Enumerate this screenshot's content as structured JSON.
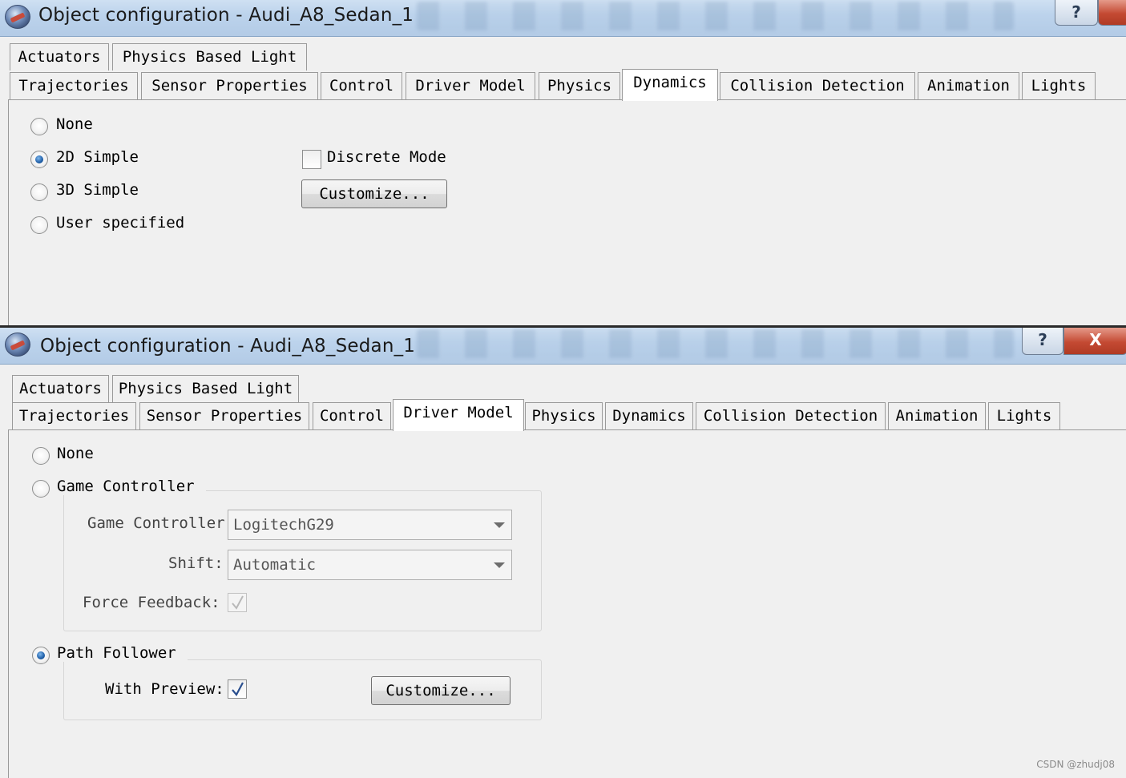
{
  "window1": {
    "title": "Object configuration - Audi_A8_Sedan_1",
    "help_label": "?",
    "tabs_row1": [
      "Actuators",
      "Physics Based Light"
    ],
    "tabs_row2": [
      "Trajectories",
      "Sensor Properties",
      "Control",
      "Driver Model",
      "Physics",
      "Dynamics",
      "Collision Detection",
      "Animation",
      "Lights"
    ],
    "active_tab": "Dynamics",
    "dynamics": {
      "options": [
        "None",
        "2D Simple",
        "3D Simple",
        "User specified"
      ],
      "selected": "2D Simple",
      "discrete_mode_label": "Discrete Mode",
      "discrete_mode_checked": false,
      "customize_label": "Customize..."
    }
  },
  "window2": {
    "title": "Object configuration - Audi_A8_Sedan_1",
    "help_label": "?",
    "close_label": "X",
    "tabs_row1": [
      "Actuators",
      "Physics Based Light"
    ],
    "tabs_row2": [
      "Trajectories",
      "Sensor Properties",
      "Control",
      "Driver Model",
      "Physics",
      "Dynamics",
      "Collision Detection",
      "Animation",
      "Lights"
    ],
    "active_tab": "Driver Model",
    "driver_model": {
      "none_label": "None",
      "game_controller_label": "Game Controller",
      "game_controller_field_label": "Game Controller",
      "game_controller_value": "LogitechG29",
      "shift_label": "Shift:",
      "shift_value": "Automatic",
      "force_feedback_label": "Force Feedback:",
      "force_feedback_checked": true,
      "path_follower_label": "Path Follower",
      "with_preview_label": "With Preview:",
      "with_preview_checked": true,
      "customize_label": "Customize...",
      "selected": "Path Follower"
    }
  },
  "watermark": "CSDN @zhudj08",
  "colors": {
    "titlebar": "#bcd3ec",
    "close_button": "#c44a33",
    "radio_selected": "#1f5fa8",
    "panel_bg": "#f0f0f0",
    "active_tab_bg": "#ffffff"
  }
}
